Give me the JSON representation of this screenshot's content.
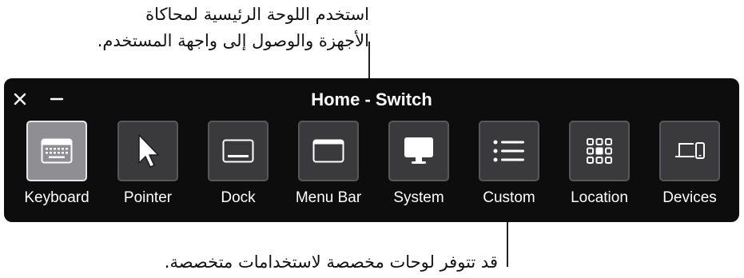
{
  "callouts": {
    "top_line1": "استخدم اللوحة الرئيسية لمحاكاة",
    "top_line2": "الأجهزة والوصول إلى واجهة المستخدم.",
    "bottom": "قد تتوفر لوحات مخصصة لاستخدامات متخصصة."
  },
  "panel": {
    "title": "Home - Switch",
    "buttons": [
      {
        "name": "keyboard",
        "label": "Keyboard",
        "icon": "keyboard-icon",
        "selected": true
      },
      {
        "name": "pointer",
        "label": "Pointer",
        "icon": "pointer-arrow-icon"
      },
      {
        "name": "dock",
        "label": "Dock",
        "icon": "dock-icon"
      },
      {
        "name": "menu-bar",
        "label": "Menu Bar",
        "icon": "menu-bar-icon"
      },
      {
        "name": "system",
        "label": "System",
        "icon": "display-icon"
      },
      {
        "name": "custom",
        "label": "Custom",
        "icon": "list-icon"
      },
      {
        "name": "location",
        "label": "Location",
        "icon": "grid-icon"
      },
      {
        "name": "devices",
        "label": "Devices",
        "icon": "devices-icon"
      }
    ]
  },
  "colors": {
    "panel_background": "#0d0d0d",
    "tile_background": "#3a3a3c",
    "tile_selected": "#8e8e93",
    "text": "#ffffff"
  }
}
